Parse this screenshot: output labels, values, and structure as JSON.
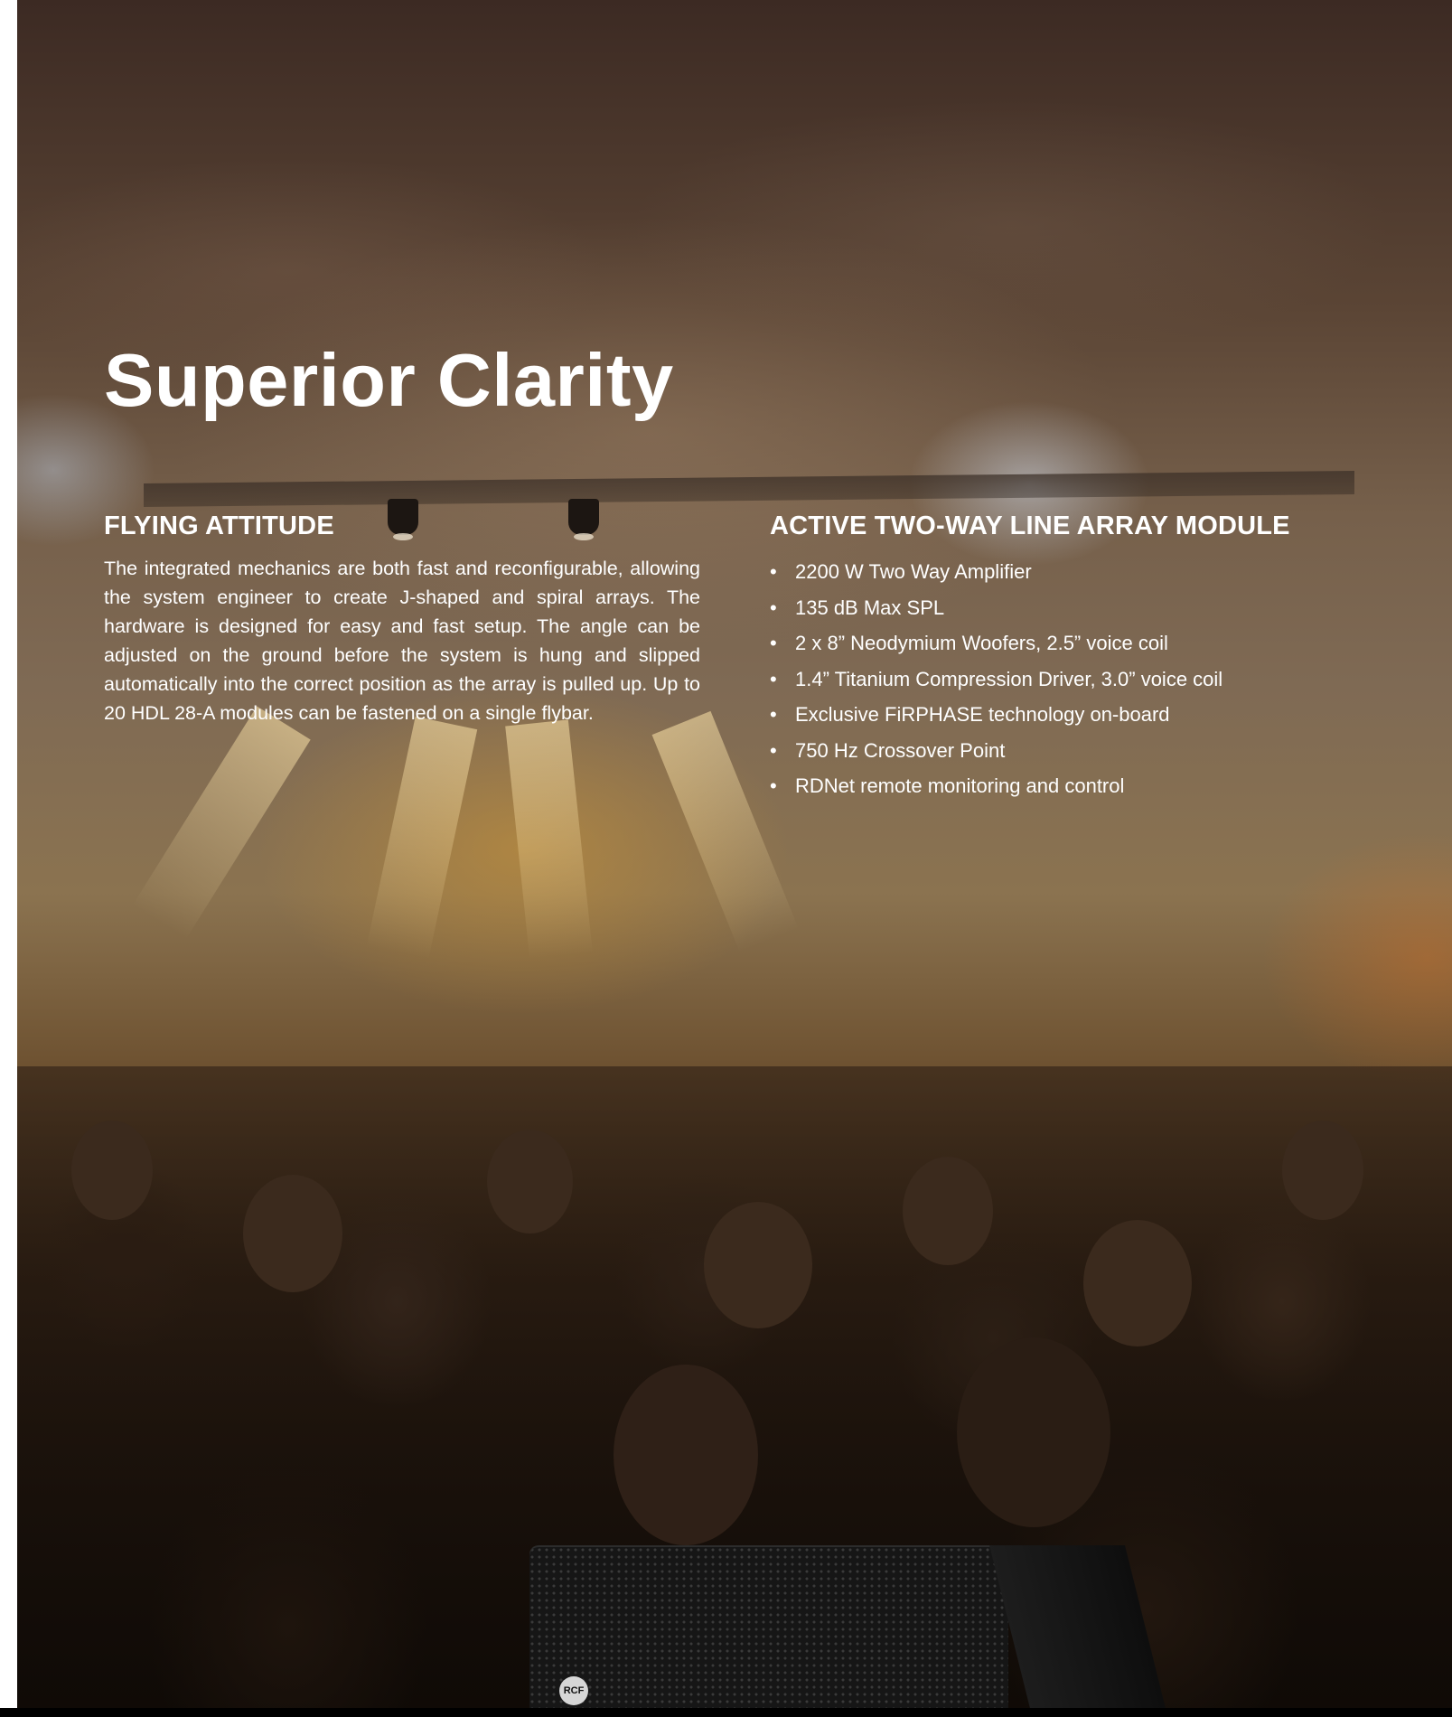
{
  "page": {
    "title": "Superior Clarity"
  },
  "left_column": {
    "heading": "FLYING ATTITUDE",
    "body": "The integrated mechanics are both fast and reconfigurable, allowing the system engineer to create J-shaped and spiral arrays. The hardware is designed for easy and fast setup. The angle can be adjusted on the ground before the system is hung and slipped automatically into the correct position as the array is pulled up. Up to 20 HDL 28-A modules can be fastened on a single flybar."
  },
  "right_column": {
    "heading": "ACTIVE TWO-WAY LINE ARRAY MODULE",
    "features": [
      "2200 W Two Way Amplifier",
      "135 dB Max SPL",
      "2 x 8” Neodymium Woofers, 2.5” voice coil",
      "1.4” Titanium Compression Driver, 3.0” voice coil",
      "Exclusive FiRPHASE technology on-board",
      "750 Hz Crossover Point",
      "RDNet remote monitoring and control"
    ]
  },
  "product": {
    "logo_text": "RCF"
  },
  "colors": {
    "text": "#ffffff",
    "background_top": "#3c2a23",
    "background_bottom": "#120c08"
  }
}
